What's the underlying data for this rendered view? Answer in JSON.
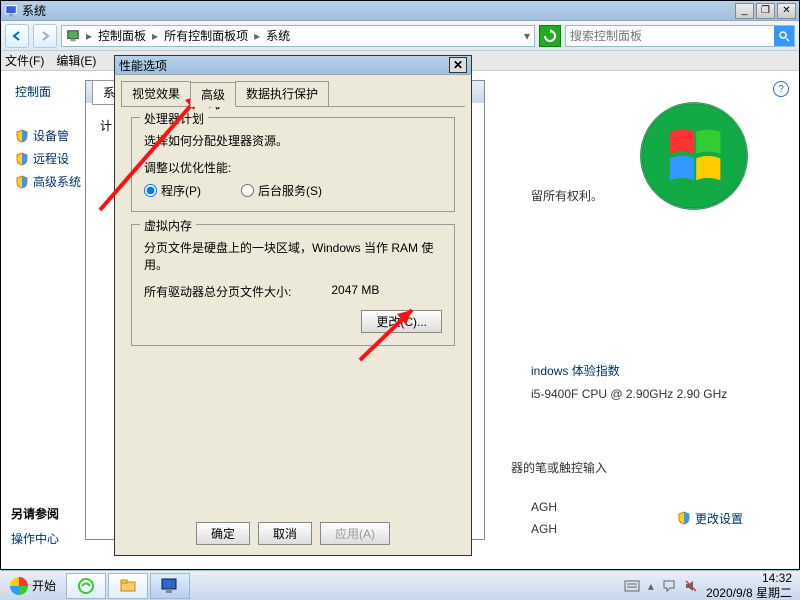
{
  "mainwin": {
    "title": "系统",
    "menu": {
      "file": "文件(F)",
      "edit": "编辑(E)"
    },
    "breadcrumb": {
      "b1": "控制面板",
      "b2": "所有控制面板项",
      "b3": "系统"
    },
    "search_placeholder": "搜索控制面板",
    "sidebar": {
      "header": "控制面",
      "items": [
        "设备管",
        "远程设",
        "高级系统"
      ]
    },
    "seealso": {
      "header": "另请参阅",
      "link": "操作中心"
    },
    "body": {
      "rights": "留所有权利。",
      "idx": "indows 体验指数",
      "cpu": "i5-9400F CPU @ 2.90GHz  2.90 GHz",
      "pen": "器的笔或触控输入",
      "wg1": "AGH",
      "wg2": "AGH",
      "change": "更改设置"
    }
  },
  "win2": {
    "tab": "系统",
    "label": "计"
  },
  "dialog": {
    "title": "性能选项",
    "tabs": {
      "t1": "视觉效果",
      "t2": "高级",
      "t3": "数据执行保护"
    },
    "sched": {
      "title": "处理器计划",
      "desc": "选择如何分配处理器资源。",
      "adj": "调整以优化性能:",
      "r1": "程序(P)",
      "r2": "后台服务(S)"
    },
    "vm": {
      "title": "虚拟内存",
      "desc": "分页文件是硬盘上的一块区域，Windows 当作 RAM 使用。",
      "total_label": "所有驱动器总分页文件大小:",
      "total_val": "2047 MB",
      "change": "更改(C)..."
    },
    "buttons": {
      "ok": "确定",
      "cancel": "取消",
      "apply": "应用(A)"
    }
  },
  "taskbar": {
    "start": "开始",
    "time": "14:32",
    "date": "2020/9/8 星期二"
  }
}
